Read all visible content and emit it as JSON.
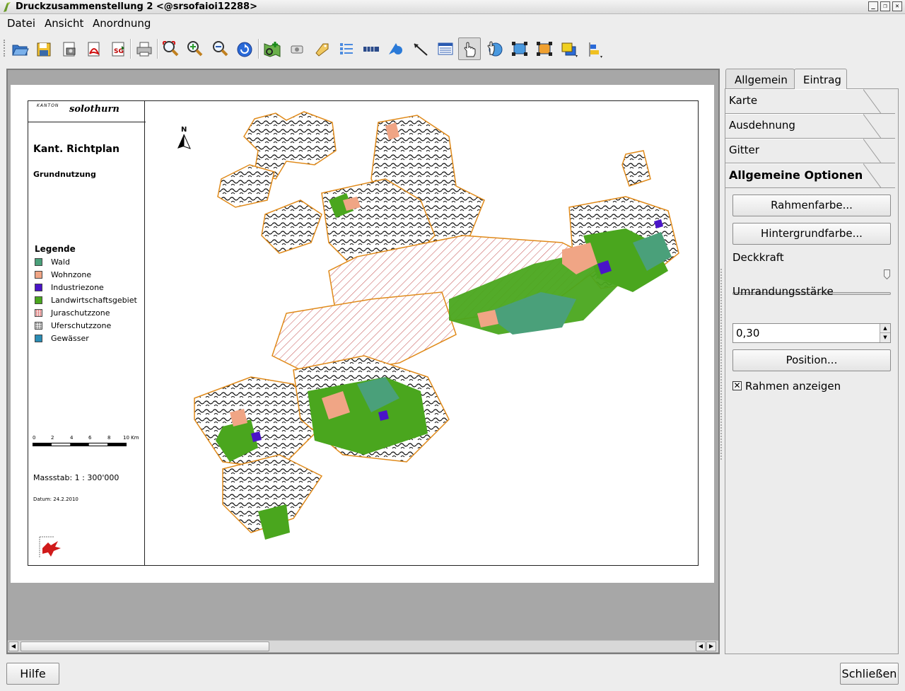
{
  "window": {
    "title": "Druckzusammenstellung 2 <@srsofaioi12288>",
    "buttons": [
      "_",
      "❐",
      "✕"
    ]
  },
  "menu": [
    "Datei",
    "Ansicht",
    "Anordnung"
  ],
  "toolbar": {
    "icons": [
      "open-template-icon",
      "save-template-icon",
      "export-image-icon",
      "export-pdf-icon",
      "export-svg-icon",
      "print-icon",
      "zoom-full-icon",
      "zoom-in-icon",
      "zoom-out-icon",
      "refresh-icon",
      "add-map-icon",
      "add-image-icon",
      "add-label-icon",
      "add-legend-icon",
      "add-scalebar-icon",
      "add-shape-icon",
      "add-arrow-icon",
      "add-table-icon",
      "select-move-icon",
      "move-content-icon",
      "group-icon",
      "ungroup-icon",
      "raise-items-icon",
      "align-items-icon"
    ],
    "active_icon": "select-move-icon"
  },
  "layout": {
    "logo": {
      "kanton": "KANTON",
      "name": "solothurn"
    },
    "title": "Kant. Richtplan",
    "subtitle": "Grundnutzung",
    "legend_title": "Legende",
    "legend_items": [
      {
        "label": "Wald",
        "color": "#4aa07a",
        "pattern": "solid"
      },
      {
        "label": "Wohnzone",
        "color": "#f0a585",
        "pattern": "solid"
      },
      {
        "label": "Industriezone",
        "color": "#4a14c8",
        "pattern": "solid"
      },
      {
        "label": "Landwirtschaftsgebiet",
        "color": "#4aa61e",
        "pattern": "solid"
      },
      {
        "label": "Juraschutzzone",
        "color": "#d04a4a",
        "pattern": "dots"
      },
      {
        "label": "Uferschutzzone",
        "color": "#6a6a6a",
        "pattern": "dots"
      },
      {
        "label": "Gewässer",
        "color": "#2a8cb4",
        "pattern": "solid"
      }
    ],
    "scale_ticks": [
      "0",
      "2",
      "4",
      "6",
      "8",
      "10 Km"
    ],
    "massstab": "Massstab: 1 : 300'000",
    "datum": "Datum: 24.2.2010",
    "north": "N",
    "gis_logo": "SO!GIS"
  },
  "dock": {
    "tabs": [
      "Allgemein",
      "Eintrag"
    ],
    "active_tab": "Eintrag",
    "sections": [
      "Karte",
      "Ausdehnung",
      "Gitter",
      "Allgemeine Optionen"
    ],
    "buttons": {
      "frame_color": "Rahmenfarbe...",
      "background_color": "Hintergrundfarbe...",
      "position": "Position..."
    },
    "opacity_label": "Deckkraft",
    "opacity_value": 1.0,
    "outline_label": "Umrandungsstärke",
    "outline_value": "0,30",
    "show_frame_label": "Rahmen anzeigen",
    "show_frame_checked": true
  },
  "footer": {
    "help": "Hilfe",
    "close": "Schließen"
  }
}
